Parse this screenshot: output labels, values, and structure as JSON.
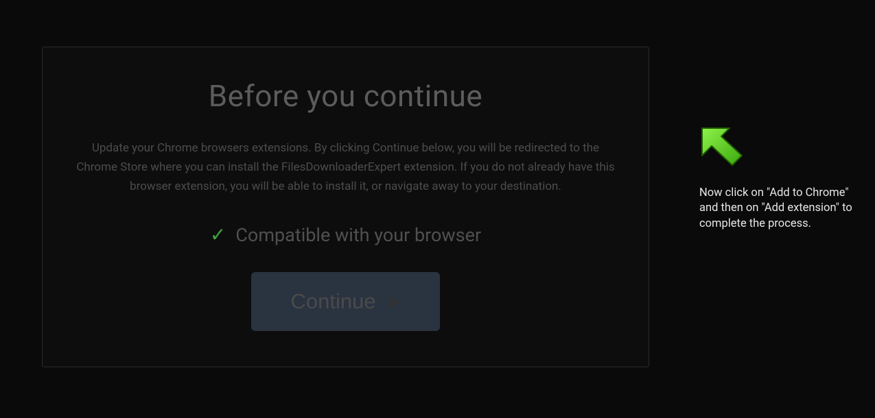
{
  "modal": {
    "title": "Before you continue",
    "body": "Update your Chrome browsers extensions. By clicking Continue below, you will be redirected to the Chrome Store where you can install the FilesDownloaderExpert extension. If you do not already have this browser extension, you will be able to install it, or navigate away to your destination.",
    "compatible_label": "Compatible with your browser",
    "continue_label": "Continue"
  },
  "tooltip": {
    "text": "Now click on \"Add to Chrome\" and then on \"Add extension\" to complete the process."
  },
  "colors": {
    "arrow_fill": "#5fce1d",
    "arrow_stroke": "#2e7a00",
    "check": "#3fa63f"
  }
}
